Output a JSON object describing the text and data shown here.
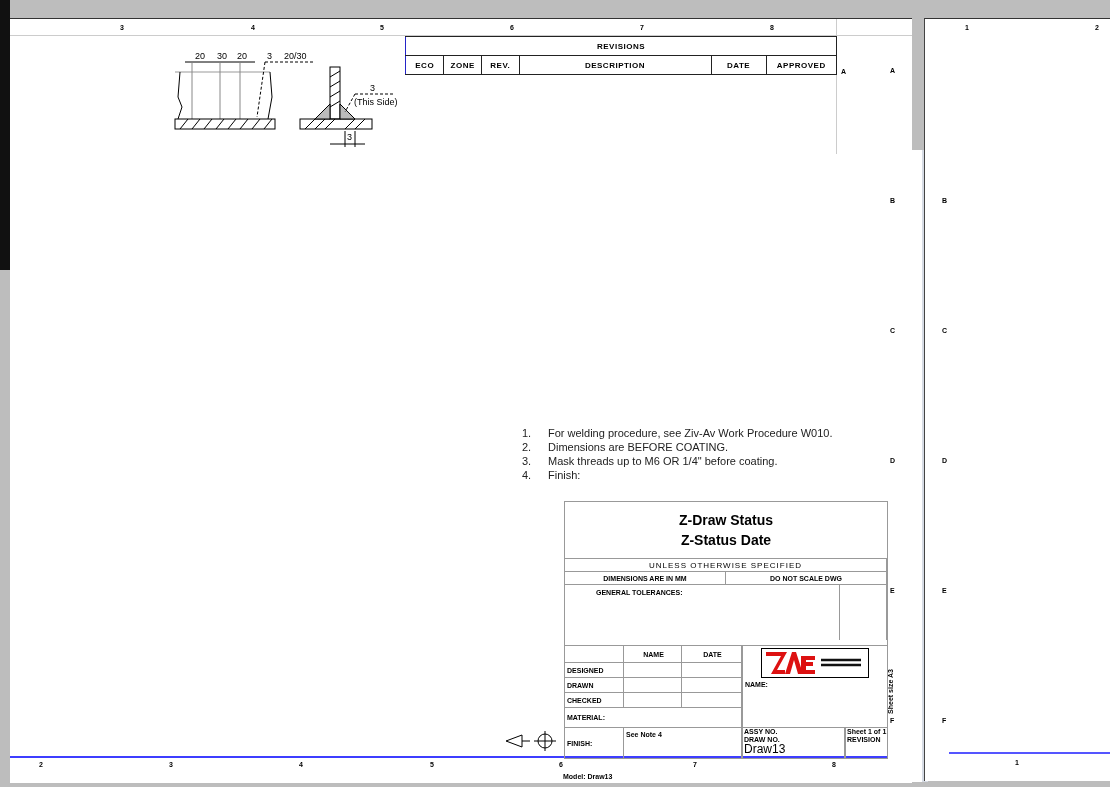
{
  "sheet": {
    "top_zones": [
      "3",
      "4",
      "5",
      "6",
      "7",
      "8"
    ],
    "bottom_zones": [
      "2",
      "3",
      "4",
      "5",
      "6",
      "7",
      "8"
    ],
    "side_zones": [
      "A"
    ],
    "model_label": "Model: Draw13",
    "sheet_size": "Sheet size A3"
  },
  "weld_detail": {
    "dims": [
      "20",
      "30",
      "20"
    ],
    "left_symbol": "3",
    "pitch": "20/30",
    "right_symbol": "3",
    "side_note": "(This Side)",
    "leg": "3"
  },
  "revisions": {
    "title": "REVISIONS",
    "columns": [
      "ECO",
      "ZONE",
      "REV.",
      "DESCRIPTION",
      "DATE",
      "APPROVED"
    ]
  },
  "notes": [
    {
      "number": "1.",
      "text": "For welding procedure, see Ziv-Av Work Procedure W010."
    },
    {
      "number": "2.",
      "text": "Dimensions are BEFORE COATING."
    },
    {
      "number": "3.",
      "text": "Mask threads up to M6 OR 1/4\" before coating."
    },
    {
      "number": "4.",
      "text": "Finish:"
    }
  ],
  "title_block": {
    "status": "Z-Draw Status",
    "status_date": "Z-Status Date",
    "unless": "UNLESS OTHERWISE SPECIFIED",
    "units": "DIMENSIONS ARE IN MM",
    "scale_note": "DO NOT SCALE DWG",
    "tolerances": "GENERAL TOLERANCES:",
    "sign_columns": [
      "NAME",
      "DATE"
    ],
    "sign_rows": [
      "DESIGNED",
      "DRAWN",
      "CHECKED"
    ],
    "material_label": "MATERIAL:",
    "finish_label": "FINISH:",
    "finish_value": "See Note 4",
    "name_label": "NAME:",
    "assy_label": "ASSY NO.",
    "sheet_of": "Sheet 1 of 1",
    "draw_no_label": "DRAW NO.",
    "draw_no": "Draw13",
    "revision_label": "REVISION"
  },
  "middle_zones": [
    "A",
    "B",
    "C",
    "D",
    "E",
    "F"
  ],
  "second_sheet": {
    "top_zones": [
      "1",
      "2"
    ],
    "side_zones": [
      "B",
      "C",
      "D",
      "E",
      "F"
    ],
    "bottom_zones": [
      "1"
    ]
  }
}
